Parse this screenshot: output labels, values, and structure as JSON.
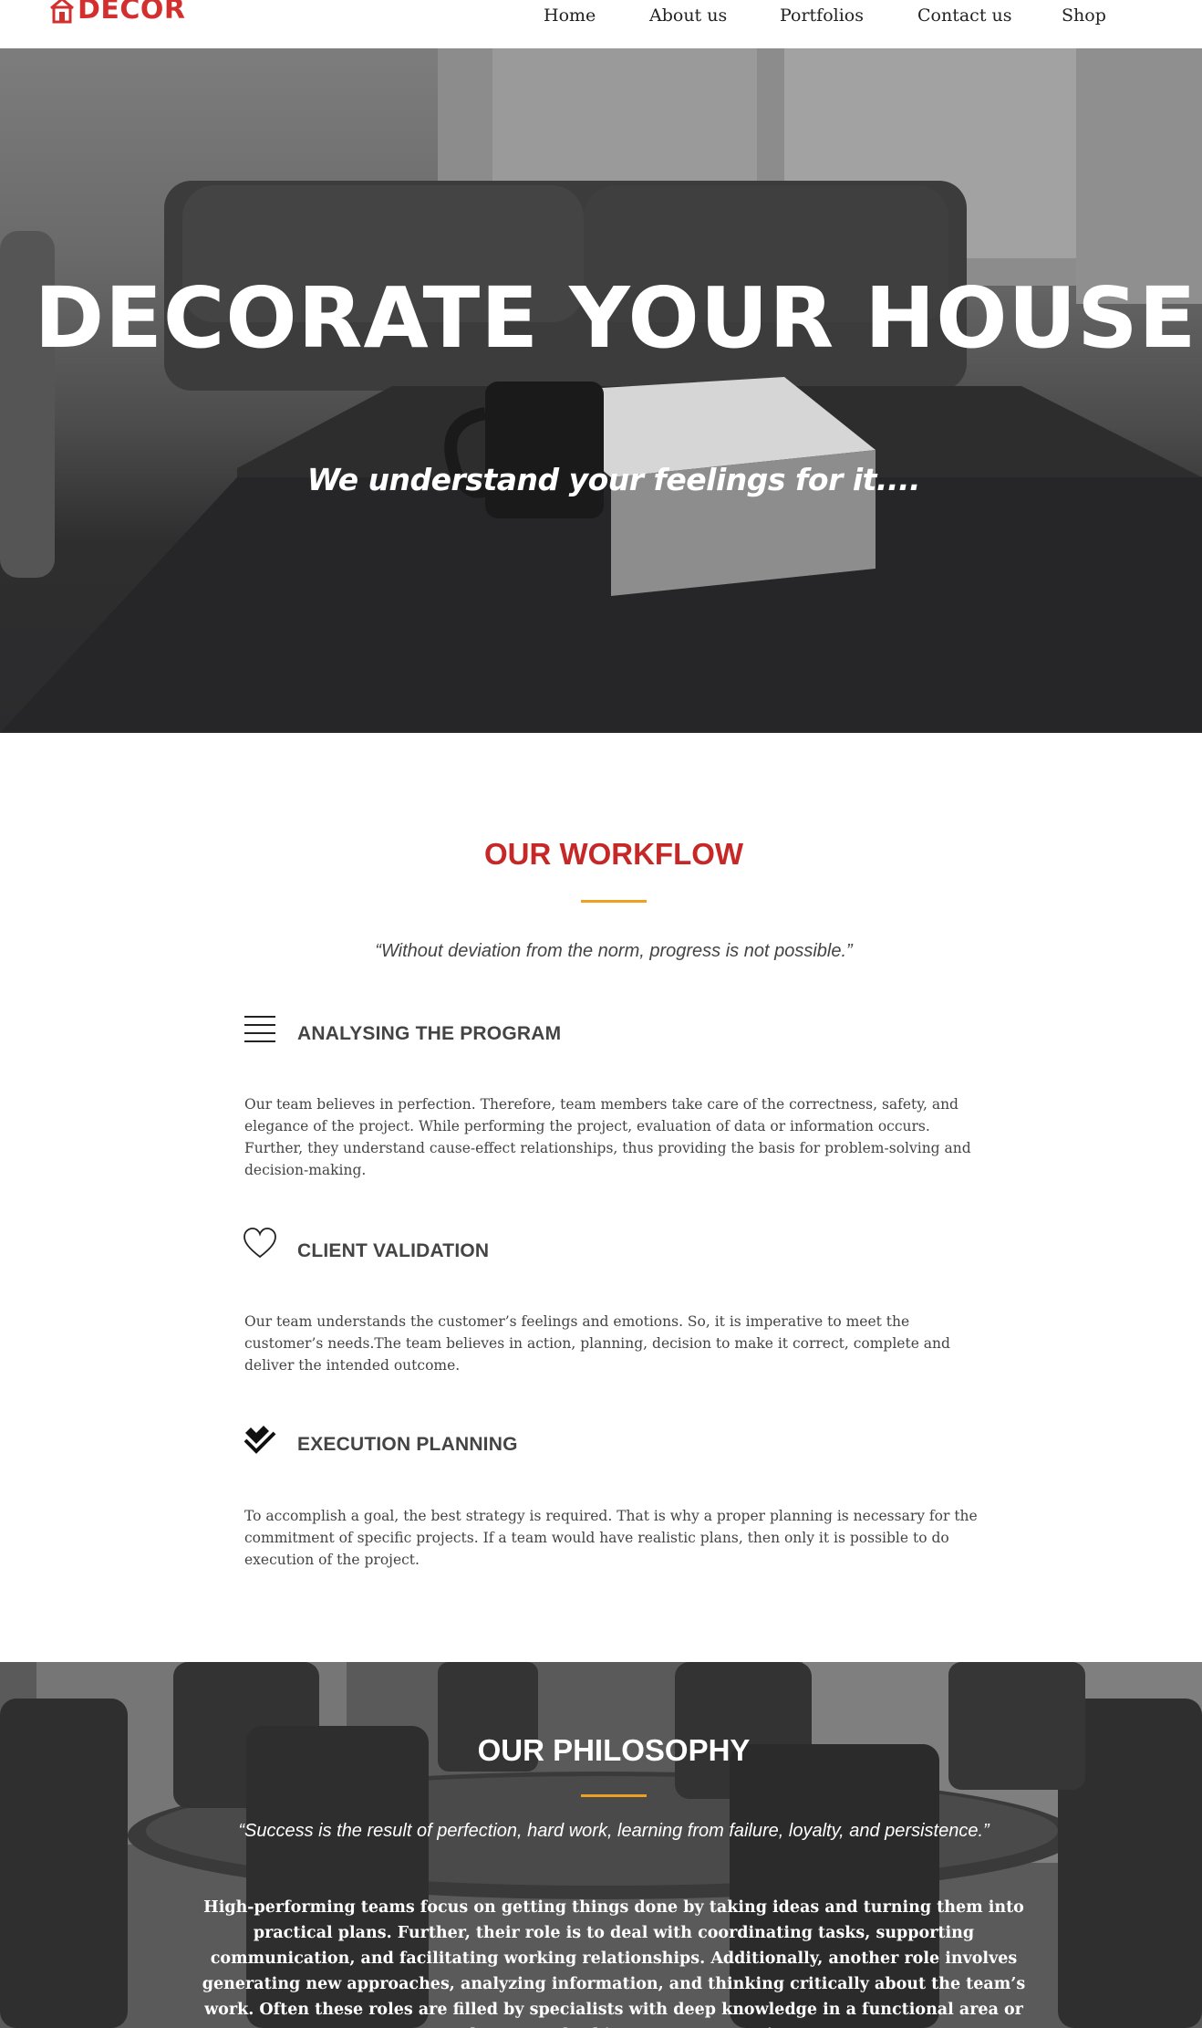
{
  "brand": {
    "logo_text": "DECOR",
    "color": "#d32f2f"
  },
  "nav": {
    "items": [
      {
        "label": "Home"
      },
      {
        "label": "About us"
      },
      {
        "label": "Portfolios"
      },
      {
        "label": "Contact us"
      },
      {
        "label": "Shop"
      }
    ]
  },
  "hero": {
    "title": "DECORATE YOUR HOUSE",
    "subtitle": "We understand your feelings for it...."
  },
  "workflow": {
    "title": "OUR WORKFLOW",
    "quote": "“Without deviation from the norm, progress is not possible.”",
    "accent_color": "#c62828",
    "rule_color": "#f0a020",
    "items": [
      {
        "icon": "menu-lines-icon",
        "title": "ANALYSING THE PROGRAM",
        "text": "Our team believes in perfection. Therefore, team members take care of the correctness, safety, and elegance of the project. While performing the project, evaluation of data or information occurs. Further, they understand cause-effect relationships, thus providing the basis for problem-solving and decision-making."
      },
      {
        "icon": "heart-icon",
        "title": "CLIENT VALIDATION",
        "text": "Our team understands the customer’s feelings and emotions. So, it is imperative to meet the customer’s needs.The team believes in action, planning, decision to make it correct, complete and deliver the intended outcome."
      },
      {
        "icon": "layered-check-icon",
        "title": "EXECUTION PLANNING",
        "text": "To accomplish a goal, the best strategy is required.  That is why a proper planning is necessary for the commitment of specific projects. If a team would have realistic plans, then only it is possible to do execution of the project."
      }
    ]
  },
  "philosophy": {
    "title": "OUR PHILOSOPHY",
    "quote": "“Success is the result of perfection, hard work, learning from failure, loyalty, and persistence.”",
    "text": "High-performing teams focus on getting things done by taking ideas and turning them into practical plans. Further, their role is to deal with coordinating tasks, supporting communication, and facilitating working relationships. Additionally, another role involves generating new approaches, analyzing information, and thinking critically about the team’s work. Often these roles are filled by specialists with deep knowledge in a functional area or another type of subject-matter expertise."
  }
}
